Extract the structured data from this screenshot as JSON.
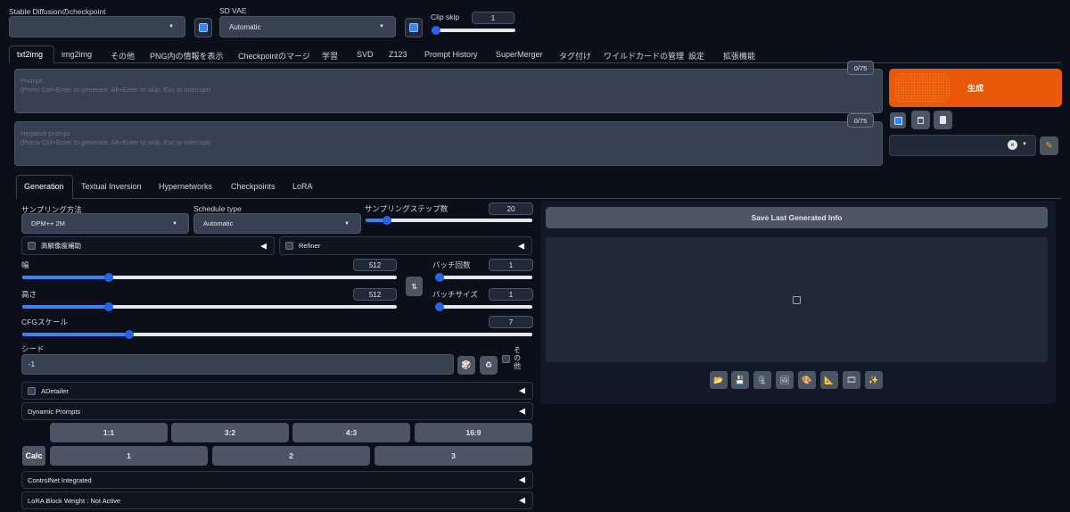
{
  "top": {
    "checkpoint_label": "Stable Diffusionのcheckpoint",
    "checkpoint_value": "",
    "vae_label": "SD VAE",
    "vae_value": "Automatic",
    "clip_label": "Clip skip",
    "clip_value": "1"
  },
  "tabs": [
    "txt2img",
    "img2img",
    "その他",
    "PNG内の情報を表示",
    "Checkpointのマージ",
    "学習",
    "SVD",
    "Z123",
    "Prompt History",
    "SuperMerger",
    "タグ付け",
    "ワイルドカードの管理",
    "設定",
    "拡張機能"
  ],
  "prompt": {
    "label": "Prompt",
    "hint": "(Press Ctrl+Enter to generate, Alt+Enter to skip, Esc to interrupt)",
    "counter": "0/75"
  },
  "negative": {
    "label": "Negative prompt",
    "hint": "(Press Ctrl+Enter to generate, Alt+Enter to skip, Esc to interrupt)",
    "counter": "0/75"
  },
  "generate_label": "生成",
  "style_icons": [
    "pencil-icon"
  ],
  "subtabs": [
    "Generation",
    "Textual Inversion",
    "Hypernetworks",
    "Checkpoints",
    "LoRA"
  ],
  "gen": {
    "sampler_label": "サンプリング方法",
    "sampler_value": "DPM++ 2M",
    "schedule_label": "Schedule type",
    "schedule_value": "Automatic",
    "steps_label": "サンプリングステップ数",
    "steps_value": "20",
    "steps_fraction": 0.13,
    "hires_label": "高解像度補助",
    "refiner_label": "Refiner",
    "width_label": "幅",
    "width_value": "512",
    "width_fraction": 0.23,
    "height_label": "高さ",
    "height_value": "512",
    "height_fraction": 0.23,
    "batch_count_label": "バッチ回数",
    "batch_count_value": "1",
    "batch_count_fraction": 0.0,
    "batch_size_label": "バッチサイズ",
    "batch_size_value": "1",
    "batch_size_fraction": 0.0,
    "cfg_label": "CFGスケール",
    "cfg_value": "7",
    "cfg_fraction": 0.21,
    "seed_label": "シード",
    "seed_value": "-1",
    "extra_label": "その他",
    "swap_icon": "⇅"
  },
  "accordions": {
    "adetailer": "ADetailer",
    "dynamic": "Dynamic Prompts",
    "controlnet": "ControlNet Integrated",
    "lora_block": "LoRA Block Weight : Not Active"
  },
  "ratios": [
    "1:1",
    "3:2",
    "4:3",
    "16:9"
  ],
  "calc_label": "Calc",
  "multipliers": [
    "1",
    "2",
    "3"
  ],
  "save_info_label": "Save Last Generated Info"
}
